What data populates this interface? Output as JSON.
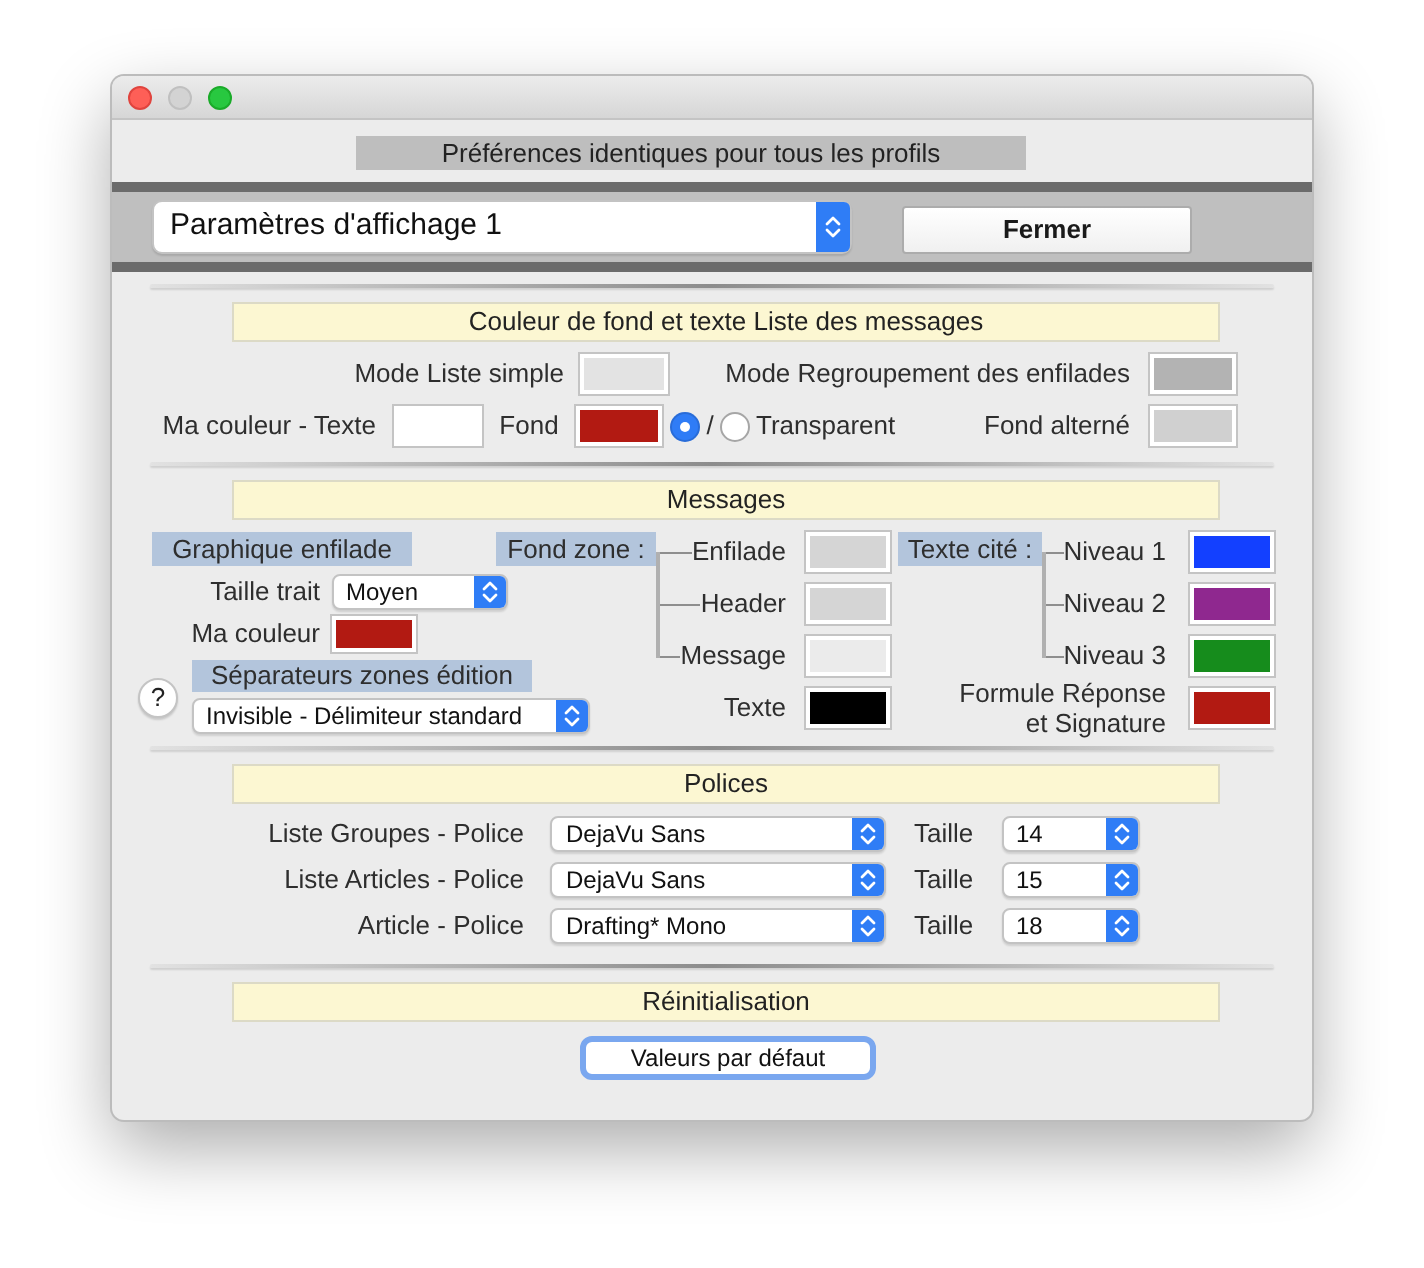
{
  "window": {
    "minimize_disabled": true
  },
  "notice": "Préférences identiques pour tous les profils",
  "toolbar": {
    "profile": "Paramètres d'affichage 1",
    "close_button": "Fermer"
  },
  "list_colors": {
    "title": "Couleur de fond et texte Liste des messages",
    "simple_mode": {
      "label": "Mode Liste simple",
      "color": "#e3e3e3"
    },
    "grouped_mode": {
      "label": "Mode Regroupement des enfilades",
      "color": "#b3b3b3"
    },
    "my_text": {
      "label": "Ma couleur - Texte",
      "color": "#ffffff"
    },
    "my_background": {
      "label": "Fond",
      "color": "#b21a12"
    },
    "background_options": [
      {
        "selected": true
      },
      {
        "label": "Transparent",
        "selected": false
      }
    ],
    "option_separator": "/",
    "alternate": {
      "label": "Fond alterné",
      "color": "#d0d0d0"
    }
  },
  "messages": {
    "title": "Messages",
    "thread_graphic": {
      "heading": "Graphique enfilade",
      "line_size": {
        "label": "Taille trait",
        "value": "Moyen"
      },
      "my_color": {
        "label": "Ma couleur",
        "color": "#b21a12"
      }
    },
    "help_button": "?",
    "edit_separators": {
      "heading": "Séparateurs zones édition",
      "value": "Invisible - Délimiteur standard"
    },
    "zone_background": {
      "heading": "Fond zone :",
      "items": [
        {
          "label": "Enfilade",
          "color": "#d5d5d5"
        },
        {
          "label": "Header",
          "color": "#d5d5d5"
        },
        {
          "label": "Message",
          "color": "#ebebeb"
        }
      ]
    },
    "text": {
      "label": "Texte",
      "color": "#000000"
    },
    "quoted_text": {
      "heading": "Texte cité :",
      "items": [
        {
          "label": "Niveau 1",
          "color": "#1340ff"
        },
        {
          "label": "Niveau 2",
          "color": "#8f288f"
        },
        {
          "label": "Niveau 3",
          "color": "#168c1c"
        }
      ]
    },
    "reply_signature": {
      "label": "Formule Réponse et Signature",
      "color": "#b21a12"
    }
  },
  "fonts": {
    "title": "Polices",
    "rows": [
      {
        "label": "Liste Groupes - Police",
        "font": "DejaVu Sans",
        "size_label": "Taille",
        "size": "14"
      },
      {
        "label": "Liste Articles - Police",
        "font": "DejaVu Sans",
        "size_label": "Taille",
        "size": "15"
      },
      {
        "label": "Article - Police",
        "font": "Drafting* Mono",
        "size_label": "Taille",
        "size": "18"
      }
    ]
  },
  "reset": {
    "title": "Réinitialisation",
    "button": "Valeurs par défaut",
    "focused": true
  }
}
